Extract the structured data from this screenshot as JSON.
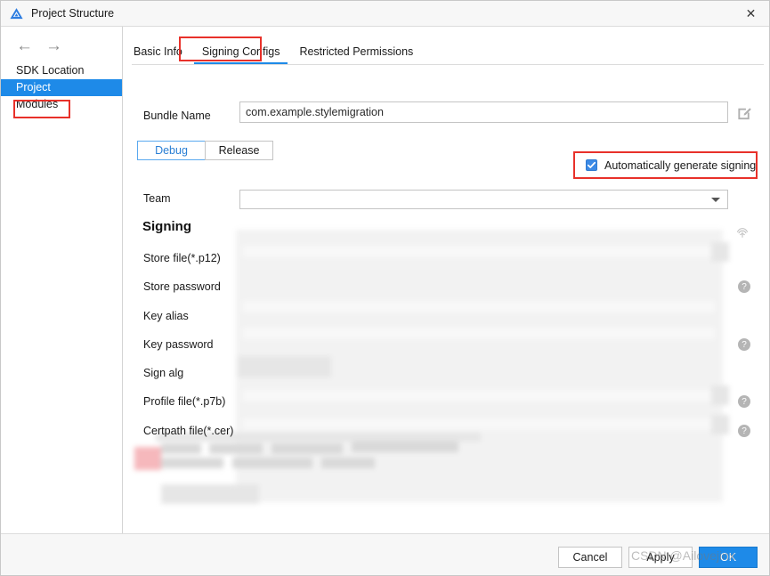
{
  "window": {
    "title": "Project Structure",
    "logo_icon": "deveco-triangle-logo",
    "close_icon": "close-icon"
  },
  "sidebar": {
    "back_icon": "arrow-left-icon",
    "forward_icon": "arrow-right-icon",
    "items": [
      {
        "label": "SDK Location",
        "selected": false
      },
      {
        "label": "Project",
        "selected": true
      },
      {
        "label": "Modules",
        "selected": false
      }
    ]
  },
  "tabs": [
    {
      "label": "Basic Info",
      "active": false
    },
    {
      "label": "Signing Configs",
      "active": true
    },
    {
      "label": "Restricted Permissions",
      "active": false
    }
  ],
  "form": {
    "bundle_name_label": "Bundle Name",
    "bundle_name_value": "com.example.stylemigration",
    "bundle_name_placeholder": "",
    "edit_icon": "edit-pencil-icon",
    "build_types": [
      {
        "label": "Debug",
        "active": true
      },
      {
        "label": "Release",
        "active": false
      }
    ],
    "auto_generate_label": "Automatically generate signing",
    "auto_generate_checked": true,
    "team_label": "Team",
    "team_value": "",
    "team_caret_icon": "chevron-down-icon",
    "signing_heading": "Signing",
    "signing_fields": [
      {
        "label": "Store file(*.p12)",
        "value": "",
        "trailing_icon": "fingerprint-icon"
      },
      {
        "label": "Store password",
        "value": "",
        "trailing_icon": "help-circle-icon"
      },
      {
        "label": "Key alias",
        "value": "",
        "trailing_icon": ""
      },
      {
        "label": "Key password",
        "value": "",
        "trailing_icon": "help-circle-icon"
      },
      {
        "label": "Sign alg",
        "value": "",
        "trailing_icon": ""
      },
      {
        "label": "Profile file(*.p7b)",
        "value": "",
        "trailing_icon": "help-circle-icon"
      },
      {
        "label": "Certpath file(*.cer)",
        "value": "",
        "trailing_icon": "help-circle-icon"
      }
    ],
    "help_icon_glyph": "?"
  },
  "footer": {
    "note": "To configure a signature, make sure that all the above items are set.",
    "link": "View the operation guide"
  },
  "buttons": {
    "cancel": "Cancel",
    "apply": "Apply",
    "ok": "OK"
  },
  "watermark": "CSDN @Ailovejinx",
  "colors": {
    "accent_blue": "#1e8ae8",
    "highlight_red": "#e8312a",
    "link_blue": "#3a8ee6",
    "checkbox_blue": "#3b8ae6"
  }
}
